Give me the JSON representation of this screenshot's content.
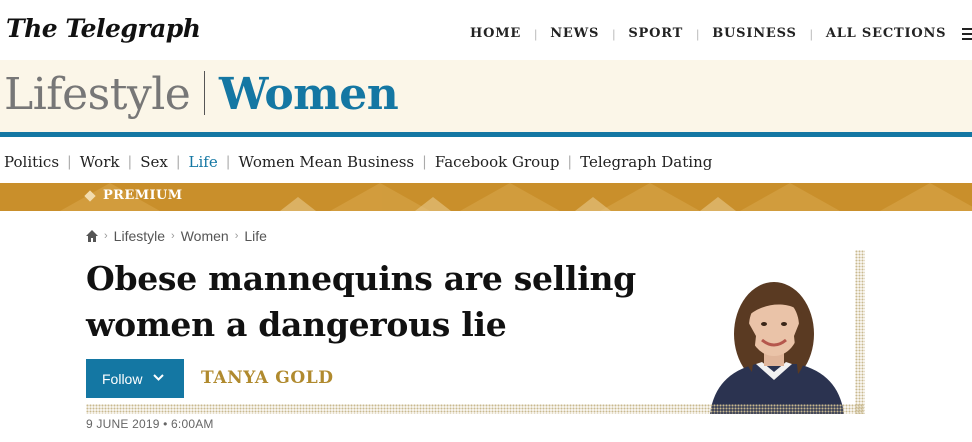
{
  "header": {
    "logo": "The Telegraph",
    "nav": [
      "HOME",
      "NEWS",
      "SPORT",
      "BUSINESS",
      "ALL SECTIONS"
    ],
    "menu_icon": "hamburger-menu-icon"
  },
  "banner": {
    "section": "Lifestyle",
    "subsection": "Women",
    "accent_color": "#1477a3",
    "background_color": "#fbf6e8"
  },
  "subnav": {
    "items": [
      "Politics",
      "Work",
      "Sex",
      "Life",
      "Women Mean Business",
      "Facebook Group",
      "Telegraph Dating"
    ],
    "active": "Life"
  },
  "premium": {
    "label": "PREMIUM",
    "color": "#c98f2b"
  },
  "breadcrumb": {
    "home_icon": "home-icon",
    "items": [
      "Lifestyle",
      "Women",
      "Life"
    ]
  },
  "article": {
    "headline_line1": "Obese mannequins are selling",
    "headline_line2": "women a dangerous lie",
    "follow_label": "Follow",
    "author": "TANYA GOLD",
    "date": "9 JUNE 2019 • 6:00AM"
  }
}
